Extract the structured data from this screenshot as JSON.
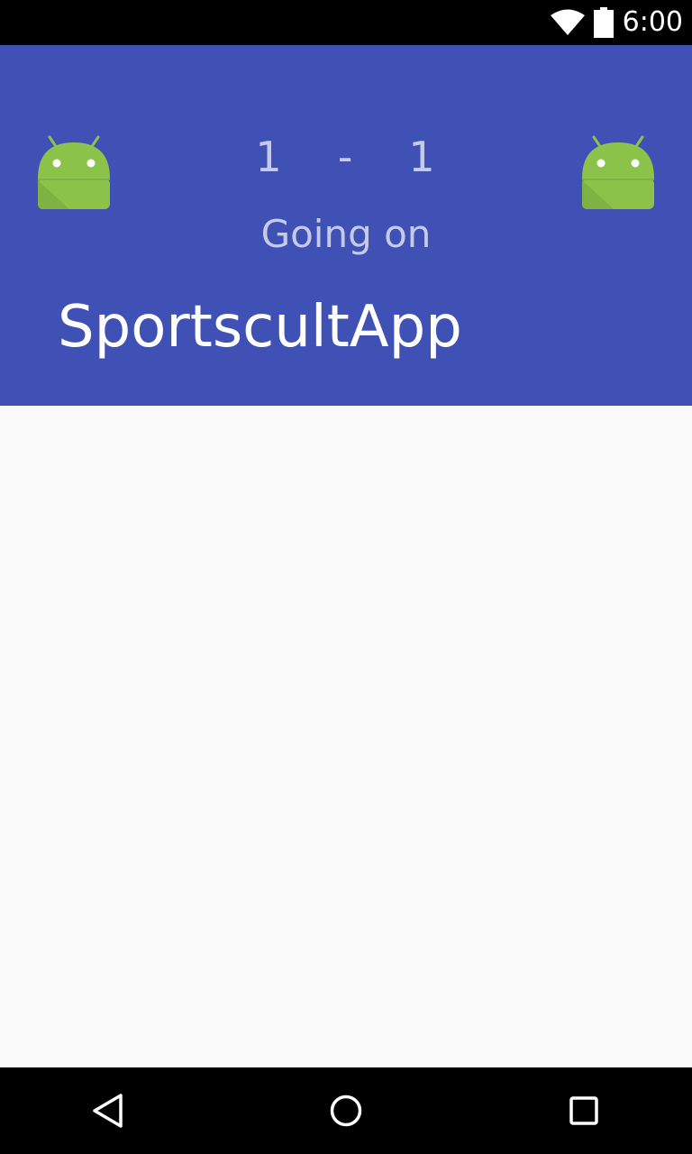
{
  "status_bar": {
    "time": "6:00",
    "icons": [
      "wifi-icon",
      "battery-icon"
    ]
  },
  "header": {
    "background_color": "#3f51b5",
    "home_team_logo": "android-icon",
    "away_team_logo": "android-icon",
    "home_score": "1",
    "separator": "-",
    "away_score": "1",
    "match_status": "Going on",
    "app_title": "SportscultApp"
  },
  "nav_bar": {
    "buttons": [
      "back-icon",
      "home-icon",
      "recents-icon"
    ]
  }
}
